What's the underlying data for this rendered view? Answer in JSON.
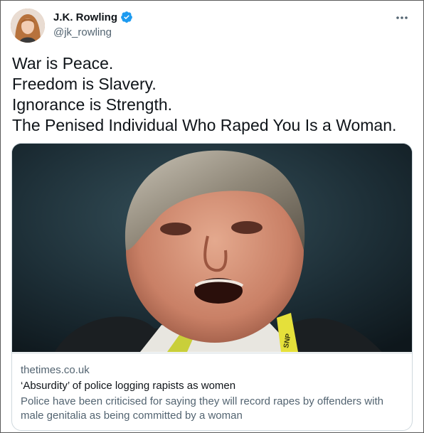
{
  "author": {
    "name": "J.K. Rowling",
    "handle": "@jk_rowling",
    "verified": true
  },
  "tweet": {
    "lines": [
      "War is Peace.",
      "Freedom is Slavery.",
      "Ignorance is Strength.",
      "The Penised Individual Who Raped You Is a Woman."
    ]
  },
  "card": {
    "domain": "thetimes.co.uk",
    "headline": "‘Absurdity’ of police logging rapists as women",
    "description": "Police have been criticised for saying they will record rapes by offenders with male genitalia as being committed by a woman",
    "lanyard_text": "SNP"
  },
  "icons": {
    "more": "more-horizontal-icon",
    "verified": "verified-badge-icon"
  },
  "colors": {
    "text_primary": "#0f1419",
    "text_secondary": "#536471",
    "verified_blue": "#1d9bf0",
    "border": "#cfd9de"
  }
}
